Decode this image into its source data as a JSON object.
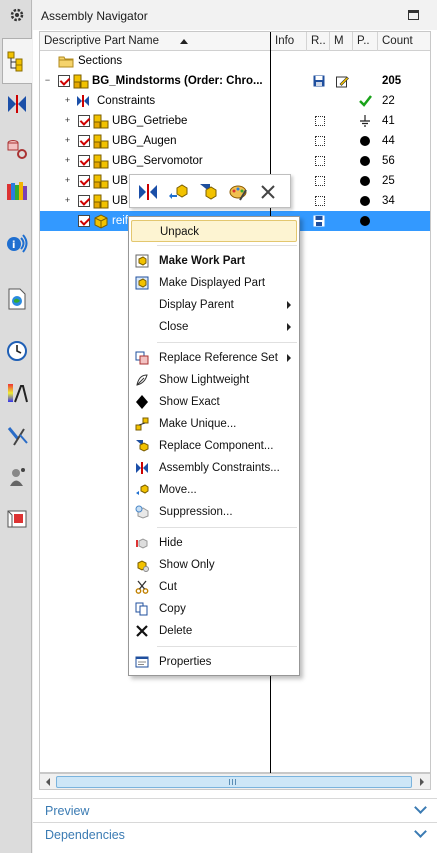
{
  "resource_bar": {
    "icons": [
      "settings-gear-icon",
      "assembly-navigator-icon",
      "constraint-navigator-icon",
      "part-navigator-icon",
      "reuse-library-icon",
      "hd3d-tools-icon",
      "web-browser-icon",
      "history-icon",
      "process-studio-icon",
      "roles-icon",
      "system-scenes-icon",
      "manufacturing-icon"
    ]
  },
  "navigator": {
    "title": "Assembly Navigator",
    "columns": {
      "name": "Descriptive Part Name",
      "info": "Info",
      "readonly": "R..",
      "modified": "M",
      "position": "P..",
      "count": "Count"
    },
    "rows": [
      {
        "label": "Sections",
        "count": ""
      },
      {
        "label": "BG_Mindstorms (Order: Chro...",
        "count": "205"
      },
      {
        "label": "Constraints",
        "count": "22"
      },
      {
        "label": "UBG_Getriebe",
        "count": "41"
      },
      {
        "label": "UBG_Augen",
        "count": "44"
      },
      {
        "label": "UBG_Servomotor",
        "count": "56"
      },
      {
        "label": "UB",
        "count": "25"
      },
      {
        "label": "UB",
        "count": "34"
      },
      {
        "label": "reif",
        "count": ""
      }
    ]
  },
  "context_menu": {
    "items": [
      {
        "label": "Unpack"
      },
      {
        "label": "Make Work Part"
      },
      {
        "label": "Make Displayed Part"
      },
      {
        "label": "Display Parent"
      },
      {
        "label": "Close"
      },
      {
        "label": "Replace Reference Set"
      },
      {
        "label": "Show Lightweight"
      },
      {
        "label": "Show Exact"
      },
      {
        "label": "Make Unique..."
      },
      {
        "label": "Replace Component..."
      },
      {
        "label": "Assembly Constraints..."
      },
      {
        "label": "Move..."
      },
      {
        "label": "Suppression..."
      },
      {
        "label": "Hide"
      },
      {
        "label": "Show Only"
      },
      {
        "label": "Cut"
      },
      {
        "label": "Copy"
      },
      {
        "label": "Delete"
      },
      {
        "label": "Properties"
      }
    ]
  },
  "panels": {
    "preview": "Preview",
    "dependencies": "Dependencies"
  },
  "colors": {
    "selection": "#3399ff",
    "accent_link": "#3b7bb3",
    "check_red": "#d00000",
    "menu_highlight": "#fdf4d2"
  }
}
